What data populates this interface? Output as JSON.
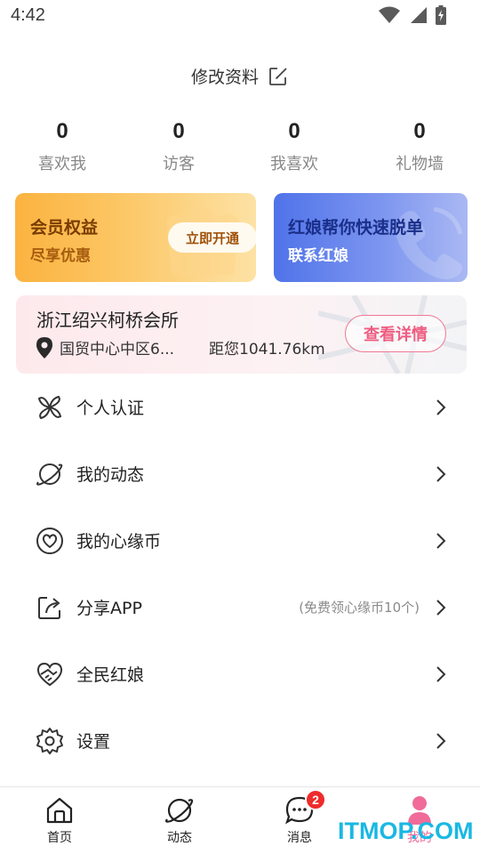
{
  "status_bar": {
    "time": "4:42"
  },
  "profile": {
    "edit_label": "修改资料"
  },
  "stats": [
    {
      "value": "0",
      "label": "喜欢我"
    },
    {
      "value": "0",
      "label": "访客"
    },
    {
      "value": "0",
      "label": "我喜欢"
    },
    {
      "value": "0",
      "label": "礼物墙"
    }
  ],
  "vip_card": {
    "title": "会员权益",
    "subtitle": "尽享优惠",
    "button": "立即开通"
  },
  "matchmaker_card": {
    "title": "红娘帮你快速脱单",
    "subtitle": "联系红娘"
  },
  "location": {
    "name": "浙江绍兴柯桥会所",
    "address": "国贸中心中区6...",
    "distance": "距您1041.76km",
    "button": "查看详情"
  },
  "menu": [
    {
      "label": "个人认证",
      "hint": "",
      "icon": "verify-icon"
    },
    {
      "label": "我的动态",
      "hint": "",
      "icon": "planet-icon"
    },
    {
      "label": "我的心缘币",
      "hint": "",
      "icon": "heart-coin-icon"
    },
    {
      "label": "分享APP",
      "hint": "(免费领心缘币10个)",
      "icon": "share-icon"
    },
    {
      "label": "全民红娘",
      "hint": "",
      "icon": "heart-handshake-icon"
    },
    {
      "label": "设置",
      "hint": "",
      "icon": "gear-icon"
    }
  ],
  "tabs": [
    {
      "label": "首页",
      "icon": "home-icon"
    },
    {
      "label": "动态",
      "icon": "planet-icon"
    },
    {
      "label": "消息",
      "icon": "chat-icon",
      "badge": "2"
    },
    {
      "label": "我的",
      "icon": "profile-icon"
    }
  ],
  "watermark": "ITMOP.COM",
  "colors": {
    "accent_pink": "#ef5d80",
    "vip_gold": "#fbb340",
    "matchmaker_blue": "#4f73e9",
    "badge_red": "#ef2b2b"
  }
}
